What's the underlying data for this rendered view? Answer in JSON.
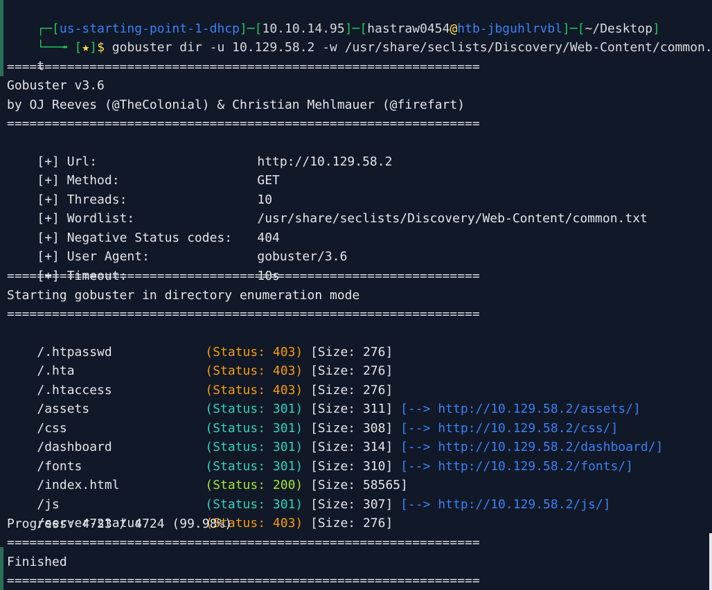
{
  "prompt": {
    "env": "us-starting-point-1-dhcp",
    "ip": "10.10.14.95",
    "user": "hastraw0454",
    "host": "htb-jbguhlrvbl",
    "cwd": "~/Desktop",
    "star": "★",
    "command": "gobuster dir -u 10.129.58.2 -w /usr/share/seclists/Discovery/Web-Content/common.tx",
    "command_wrap": "t"
  },
  "separator": "===============================================================",
  "banner": {
    "title": "Gobuster v3.6",
    "authors": "by OJ Reeves (@TheColonial) & Christian Mehlmauer (@firefart)"
  },
  "config": [
    {
      "key": "[+] Url:",
      "value": "http://10.129.58.2"
    },
    {
      "key": "[+] Method:",
      "value": "GET"
    },
    {
      "key": "[+] Threads:",
      "value": "10"
    },
    {
      "key": "[+] Wordlist:",
      "value": "/usr/share/seclists/Discovery/Web-Content/common.txt"
    },
    {
      "key": "[+] Negative Status codes:",
      "value": "404"
    },
    {
      "key": "[+] User Agent:",
      "value": "gobuster/3.6"
    },
    {
      "key": "[+] Timeout:",
      "value": "10s"
    }
  ],
  "mode_line": "Starting gobuster in directory enumeration mode",
  "results": [
    {
      "path": "/.htpasswd",
      "status": "(Status: 403)",
      "code": "403",
      "size": "[Size: 276]",
      "redirect": ""
    },
    {
      "path": "/.hta",
      "status": "(Status: 403)",
      "code": "403",
      "size": "[Size: 276]",
      "redirect": ""
    },
    {
      "path": "/.htaccess",
      "status": "(Status: 403)",
      "code": "403",
      "size": "[Size: 276]",
      "redirect": ""
    },
    {
      "path": "/assets",
      "status": "(Status: 301)",
      "code": "301",
      "size": "[Size: 311]",
      "redirect": "[--> http://10.129.58.2/assets/]"
    },
    {
      "path": "/css",
      "status": "(Status: 301)",
      "code": "301",
      "size": "[Size: 308]",
      "redirect": "[--> http://10.129.58.2/css/]"
    },
    {
      "path": "/dashboard",
      "status": "(Status: 301)",
      "code": "301",
      "size": "[Size: 314]",
      "redirect": "[--> http://10.129.58.2/dashboard/]"
    },
    {
      "path": "/fonts",
      "status": "(Status: 301)",
      "code": "301",
      "size": "[Size: 310]",
      "redirect": "[--> http://10.129.58.2/fonts/]"
    },
    {
      "path": "/index.html",
      "status": "(Status: 200)",
      "code": "200",
      "size": "[Size: 58565]",
      "redirect": ""
    },
    {
      "path": "/js",
      "status": "(Status: 301)",
      "code": "301",
      "size": "[Size: 307]",
      "redirect": "[--> http://10.129.58.2/js/]"
    },
    {
      "path": "/server-status",
      "status": "(Status: 403)",
      "code": "403",
      "size": "[Size: 276]",
      "redirect": ""
    }
  ],
  "progress": "Progress: 4723 / 4724 (99.98%)",
  "finished": "Finished",
  "colors": {
    "background": "#111827",
    "status_403": "#f59e0b",
    "status_301": "#2dd4bf",
    "status_200": "#a3e635",
    "link": "#3b82f6",
    "prompt_bracket": "#22c55e"
  }
}
